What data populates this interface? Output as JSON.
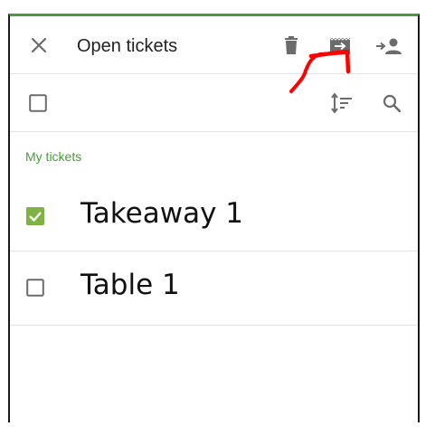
{
  "toolbar": {
    "title": "Open tickets",
    "icons": [
      "close-icon",
      "trash-icon",
      "move-ticket-icon",
      "assign-user-icon"
    ]
  },
  "subbar": {
    "icons": [
      "select-all-checkbox",
      "sort-icon",
      "search-icon"
    ]
  },
  "section": {
    "label": "My tickets"
  },
  "tickets": [
    {
      "label": "Takeaway 1",
      "checked": true
    },
    {
      "label": "Table 1",
      "checked": false
    }
  ],
  "colors": {
    "accent": "#4a9a3c",
    "annotation": "#ff0000",
    "icon": "#757575"
  }
}
